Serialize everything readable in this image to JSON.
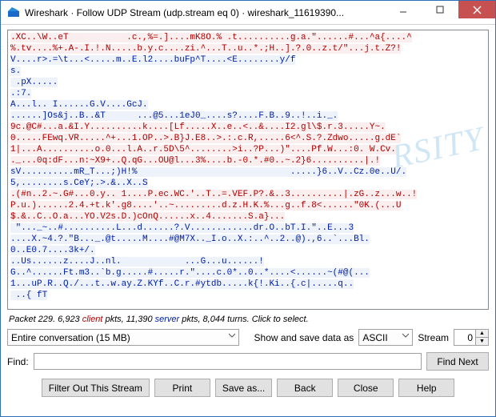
{
  "titlebar": {
    "title": "Wireshark · Follow UDP Stream (udp.stream eq 0) · wireshark_11619390..."
  },
  "stream_lines": [
    {
      "cls": "client",
      "text": ".XC..\\W..eT           .c.,%=.]....mK8O.% .t..........g.a.\"......#...^a{....^"
    },
    {
      "cls": "client",
      "text": "%.tv....%+.A-.I.!.N.....b.y.c....zi.^...T..u..*.;H..].?.0..z.t/\"...j.t.Z?!"
    },
    {
      "cls": "server",
      "text": "V....r>.=\\t...<.....m..E.l2....buFp^T....<E........y/f"
    },
    {
      "cls": "server",
      "text": "s."
    },
    {
      "cls": "server",
      "text": " .pX....."
    },
    {
      "cls": "server",
      "text": ".:7."
    },
    {
      "cls": "server",
      "text": "A...l.. I......G.V....GcJ."
    },
    {
      "cls": "server",
      "text": "......]Os&j..B..&T      ...@5...1eJ0_....s?....F.B..9..!..i._."
    },
    {
      "cls": "client",
      "text": "9c.@C#...a.&I.Y..........k....[Lf.....X..e..<..&....I2.gl\\$.r.3.....Y~."
    },
    {
      "cls": "client",
      "text": "0.....FEwq.VR.....^+...1.OP..>.B}J.E8..>.:.c.R,.....6<^.S.?.Zdwo.....g.dE`"
    },
    {
      "cls": "client",
      "text": "1|...A..........o.0...l.A..r.5D\\5^........>i..?P...)\"....Pf.W...:0. W.Cv."
    },
    {
      "cls": "client",
      "text": "._...0q:dF...n:~X9+..Q.qG...OU@l...3%....b.-0.*.#0..~.2}6..........|.!"
    },
    {
      "cls": "server",
      "text": "sV..........mR_T...;)H!%                             .....}6..V..Cz.0e..U/."
    },
    {
      "cls": "server",
      "text": "5,........s.CeY;.>.&..X..S"
    },
    {
      "cls": "client",
      "text": ".(#n..2.~.G#...0.y.. 1....P.ec.WC.'..T..=.VEF.P?.&..3..........|.zG..z...w..!"
    },
    {
      "cls": "client",
      "text": "P.u.)......2.4.+t.k'.g8....'..~.........d.z.H.K.%...g..f.8<......\"0K.(...U"
    },
    {
      "cls": "client",
      "text": "$.&..C..O.a...YO.V2s.D.)cOnQ......x..4.......S.a}..."
    },
    {
      "cls": "server",
      "text": " \"..._~..#..........L...d......?.V............dr.O..bT.I.\"..E...3"
    },
    {
      "cls": "server",
      "text": "....X.~4.?.\"B..._.@t.....M....#@M7X.._I.o..X.:..^..2..@).,6..`...Bl."
    },
    {
      "cls": "server",
      "text": "0..E0.7....3k+/."
    },
    {
      "cls": "server",
      "text": "..Us......z....J..nl.            ...G...u......!"
    },
    {
      "cls": "server",
      "text": "G..^......Ft.m3..`b.g.....#.....r.\"....c.0*..0..*....<......~(#@(..."
    },
    {
      "cls": "server",
      "text": "1...uP.R..Q./...t..w.ay.Z.KYf..C.r.#ytdb.....k{!.Ki..{.c|.....q.."
    },
    {
      "cls": "server",
      "text": " ..{ fT"
    }
  ],
  "status": {
    "prefix": "Packet 229. 6,923 ",
    "client_label": "client",
    "mid": " pkts, 11,390 ",
    "server_label": "server",
    "suffix": " pkts, 8,044 turns. Click to select."
  },
  "filter_row": {
    "conversation": "Entire conversation (15 MB)",
    "show_as_label": "Show and save data as",
    "format": "ASCII",
    "stream_label": "Stream",
    "stream_value": "0"
  },
  "find_row": {
    "label": "Find:",
    "value": "",
    "button": "Find Next"
  },
  "buttons": {
    "filter_out": "Filter Out This Stream",
    "print": "Print",
    "save_as": "Save as...",
    "back": "Back",
    "close": "Close",
    "help": "Help"
  },
  "watermark": "RSITY"
}
